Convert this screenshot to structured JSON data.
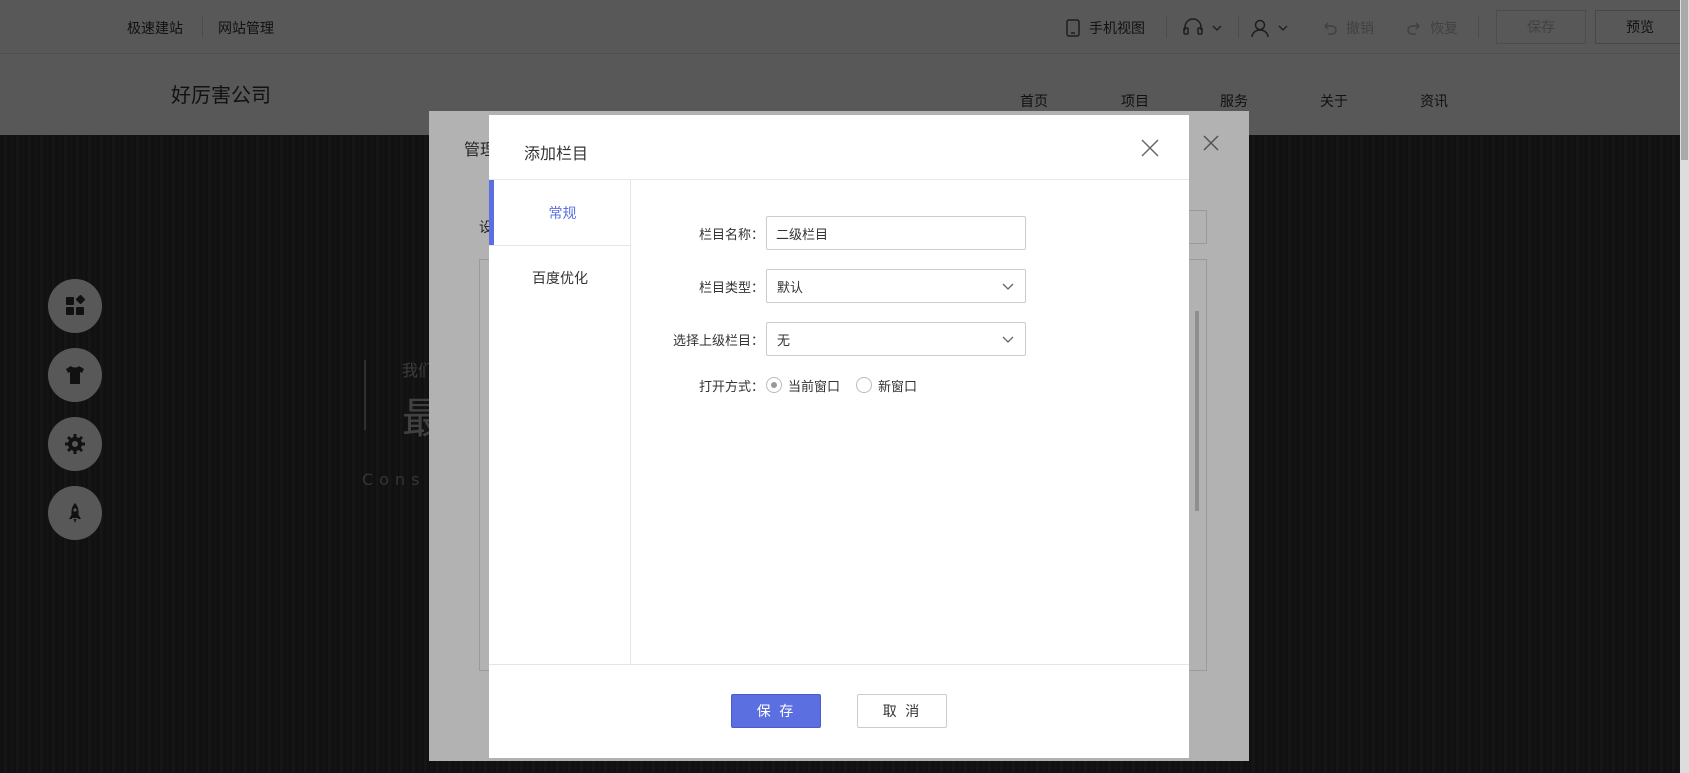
{
  "topbar": {
    "left_links": [
      "极速建站",
      "网站管理"
    ],
    "mobile_view": "手机视图",
    "undo": "撤销",
    "redo": "恢复",
    "save": "保存",
    "preview": "预览"
  },
  "site": {
    "logo": "好厉害公司",
    "nav": [
      "首页",
      "项目",
      "服务",
      "关于",
      "资讯"
    ]
  },
  "hero": {
    "small_text": "我们",
    "big_text": "最",
    "en_text": "Cons"
  },
  "sidebar_icons": [
    "layout-icon",
    "shirt-icon",
    "gear-icon",
    "rocket-icon"
  ],
  "bg_modal": {
    "title": "管理",
    "label": "设"
  },
  "modal": {
    "title": "添加栏目",
    "tabs": [
      "常规",
      "百度优化"
    ],
    "active_tab": 0,
    "fields": {
      "name_label": "栏目名称：",
      "name_value": "二级栏目",
      "type_label": "栏目类型：",
      "type_value": "默认",
      "parent_label": "选择上级栏目：",
      "parent_value": "无",
      "open_label": "打开方式：",
      "open_options": [
        "当前窗口",
        "新窗口"
      ],
      "open_selected": 0
    },
    "save_label": "保 存",
    "cancel_label": "取 消"
  },
  "colors": {
    "accent": "#5b6fe0"
  }
}
